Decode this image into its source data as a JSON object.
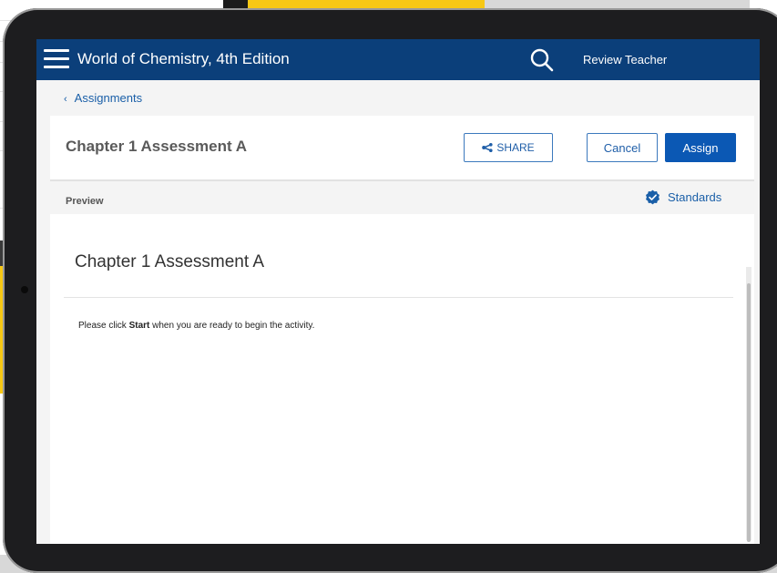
{
  "app": {
    "title": "World of Chemistry, 4th Edition",
    "user": "Review Teacher"
  },
  "breadcrumb": {
    "chevron": "‹",
    "label": "Assignments"
  },
  "card": {
    "title": "Chapter 1 Assessment A",
    "share_label": "SHARE",
    "cancel_label": "Cancel",
    "assign_label": "Assign"
  },
  "preview": {
    "label": "Preview",
    "standards_label": "Standards",
    "title": "Chapter 1 Assessment A",
    "instruction_prefix": "Please click ",
    "instruction_bold": "Start",
    "instruction_suffix": " when you are ready to begin the activity."
  },
  "icons": {
    "menu": "menu-icon",
    "search": "search-icon",
    "share": "share-icon",
    "standards": "verified-badge-icon"
  },
  "colors": {
    "header": "#0b3f7a",
    "accent": "#0b58b4",
    "link": "#1a5fa8"
  }
}
